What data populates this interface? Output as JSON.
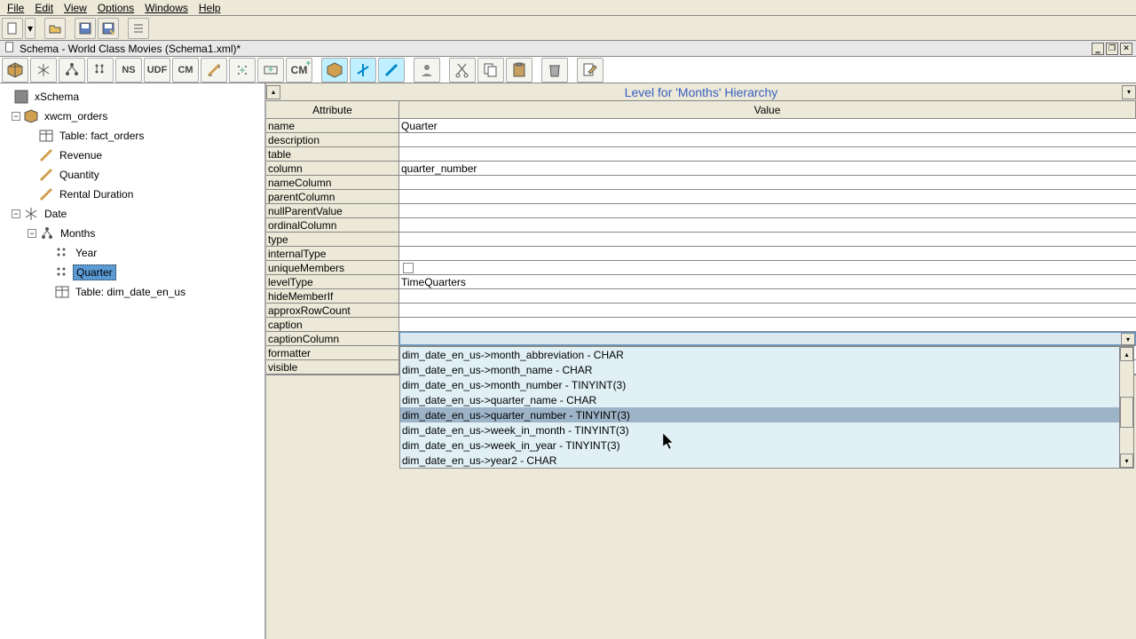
{
  "menubar": [
    "File",
    "Edit",
    "View",
    "Options",
    "Windows",
    "Help"
  ],
  "document_title": "Schema - World Class Movies (Schema1.xml)*",
  "schema_toolbar_text": [
    "NS",
    "UDF",
    "CM",
    "CM"
  ],
  "tree": {
    "root": "xSchema",
    "cube": "xwcm_orders",
    "fact_table": "Table: fact_orders",
    "measures": [
      "Revenue",
      "Quantity",
      "Rental Duration"
    ],
    "dimension": "Date",
    "hierarchy": "Months",
    "levels": [
      "Year",
      "Quarter"
    ],
    "dim_table": "Table: dim_date_en_us"
  },
  "detail_title": "Level for 'Months' Hierarchy",
  "columns": {
    "attr": "Attribute",
    "val": "Value"
  },
  "properties": [
    {
      "attr": "name",
      "val": "Quarter"
    },
    {
      "attr": "description",
      "val": ""
    },
    {
      "attr": "table",
      "val": ""
    },
    {
      "attr": "column",
      "val": "quarter_number"
    },
    {
      "attr": "nameColumn",
      "val": ""
    },
    {
      "attr": "parentColumn",
      "val": ""
    },
    {
      "attr": "nullParentValue",
      "val": ""
    },
    {
      "attr": "ordinalColumn",
      "val": ""
    },
    {
      "attr": "type",
      "val": ""
    },
    {
      "attr": "internalType",
      "val": ""
    },
    {
      "attr": "uniqueMembers",
      "val": "",
      "checkbox": true
    },
    {
      "attr": "levelType",
      "val": "TimeQuarters"
    },
    {
      "attr": "hideMemberIf",
      "val": ""
    },
    {
      "attr": "approxRowCount",
      "val": ""
    },
    {
      "attr": "caption",
      "val": ""
    },
    {
      "attr": "captionColumn",
      "val": "",
      "dropdown": true
    },
    {
      "attr": "formatter",
      "val": ""
    },
    {
      "attr": "visible",
      "val": ""
    }
  ],
  "dropdown_options": [
    "dim_date_en_us->month_abbreviation - CHAR",
    "dim_date_en_us->month_name - CHAR",
    "dim_date_en_us->month_number - TINYINT(3)",
    "dim_date_en_us->quarter_name - CHAR",
    "dim_date_en_us->quarter_number - TINYINT(3)",
    "dim_date_en_us->week_in_month - TINYINT(3)",
    "dim_date_en_us->week_in_year - TINYINT(3)",
    "dim_date_en_us->year2 - CHAR"
  ],
  "dropdown_highlight_index": 4
}
